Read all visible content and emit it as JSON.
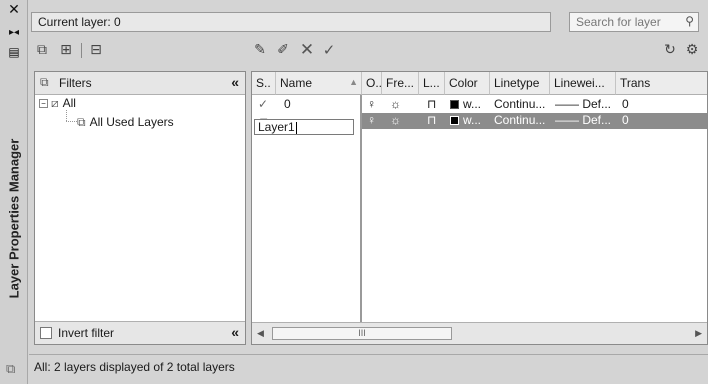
{
  "palette": {
    "title": "Layer Properties Manager",
    "close_icon": "close-icon",
    "autohide_icon": "autohide-icon",
    "properties_icon": "properties-icon"
  },
  "header": {
    "current_layer": "Current layer: 0",
    "search_placeholder": "Search for layer",
    "search_icon": "search-icon"
  },
  "toolbar": {
    "left_icons": [
      "new-property-filter-icon",
      "new-group-filter-icon",
      "layer-states-manager-icon"
    ],
    "right_icons": [
      "new-layer-icon",
      "new-layer-vp-frozen-icon",
      "delete-layer-icon",
      "set-current-icon"
    ],
    "far_right_icons": [
      "refresh-icon",
      "settings-icon"
    ]
  },
  "filters": {
    "header": "Filters",
    "tree": [
      {
        "label": "All",
        "icon": "all-filter-icon"
      },
      {
        "label": "All Used Layers",
        "icon": "used-layers-filter-icon"
      }
    ],
    "invert_filter": "Invert filter",
    "collapse": "«"
  },
  "grid": {
    "columns": [
      "S..",
      "Name",
      "O..",
      "Fre...",
      "L...",
      "Color",
      "Linetype",
      "Linewei...",
      "Trans"
    ],
    "rows": [
      {
        "status": "✓",
        "name": "0",
        "color": "w...",
        "linetype": "Continu...",
        "lineweight": "Def...",
        "transparency": "0",
        "selected": false
      },
      {
        "status": "▱",
        "name": "Layer1",
        "color": "w...",
        "linetype": "Continu...",
        "lineweight": "Def...",
        "transparency": "0",
        "selected": true
      }
    ],
    "scroll_thumb": "III"
  },
  "status_bar": {
    "text": "All: 2 layers displayed of 2 total layers"
  },
  "colors": {
    "panel_bg": "#d4d4d4",
    "grid_bg": "#ffffff",
    "selected_row": "#8c8c8c"
  }
}
